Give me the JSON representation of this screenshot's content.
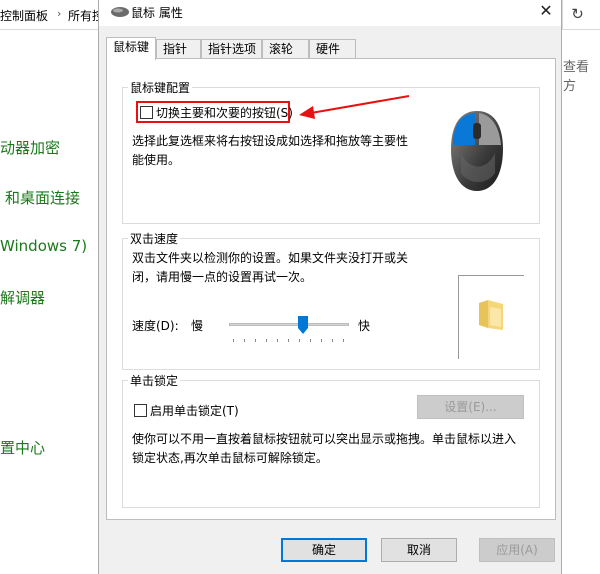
{
  "background": {
    "breadcrumb": [
      "控制面板",
      "所有控"
    ],
    "breadcrumb_sep": "›",
    "refresh_icon": "↻",
    "search_text": "查看方",
    "links": [
      "动器加密",
      "和桌面连接",
      "Windows 7)",
      "解调器",
      "置中心"
    ]
  },
  "dialog": {
    "title": "鼠标 属性",
    "close_label": "✕",
    "tabs": [
      "鼠标键",
      "指针",
      "指针选项",
      "滚轮",
      "硬件"
    ],
    "button_config": {
      "group_title": "鼠标键配置",
      "checkbox_label": "切换主要和次要的按钮(S)",
      "checked": false,
      "description": "选择此复选框来将右按钮设成如选择和拖放等主要性能使用。"
    },
    "double_click": {
      "group_title": "双击速度",
      "description": "双击文件夹以检测你的设置。如果文件夹没打开或关闭，请用慢一点的设置再试一次。",
      "speed_label": "速度(D):",
      "slow_label": "慢",
      "fast_label": "快",
      "speed_value": 0.58
    },
    "click_lock": {
      "group_title": "单击锁定",
      "checkbox_label": "启用单击锁定(T)",
      "checked": false,
      "settings_button": "设置(E)...",
      "description": "使你可以不用一直按着鼠标按钮就可以突出显示或拖拽。单击鼠标以进入锁定状态,再次单击鼠标可解除锁定。"
    },
    "buttons": {
      "ok": "确定",
      "cancel": "取消",
      "apply": "应用(A)"
    },
    "colors": {
      "accent": "#0078d7",
      "highlight": "#e81010",
      "link": "#1a7a1a"
    }
  }
}
